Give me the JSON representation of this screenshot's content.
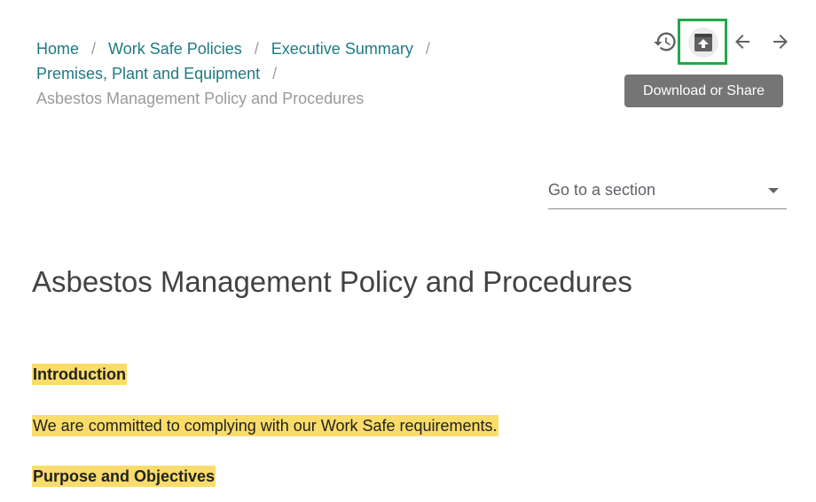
{
  "breadcrumb": {
    "items": [
      {
        "label": "Home"
      },
      {
        "label": "Work Safe Policies"
      },
      {
        "label": "Executive Summary"
      },
      {
        "label": "Premises, Plant and Equipment"
      }
    ],
    "separator": "/",
    "current": "Asbestos Management Policy and Procedures"
  },
  "toolbar": {
    "history_icon": "history-icon",
    "download_icon": "download-share-icon",
    "back_icon": "arrow-left-icon",
    "forward_icon": "arrow-right-icon",
    "tooltip": "Download or Share",
    "highlight_color": "#22a84a"
  },
  "section_select": {
    "placeholder": "Go to a section"
  },
  "document": {
    "title": "Asbestos Management Policy and Procedures",
    "highlight_color": "#f9dc6a",
    "sections": [
      {
        "heading": "Introduction",
        "body": "We are committed to complying with our Work Safe requirements."
      },
      {
        "heading": "Purpose and Objectives"
      }
    ]
  }
}
